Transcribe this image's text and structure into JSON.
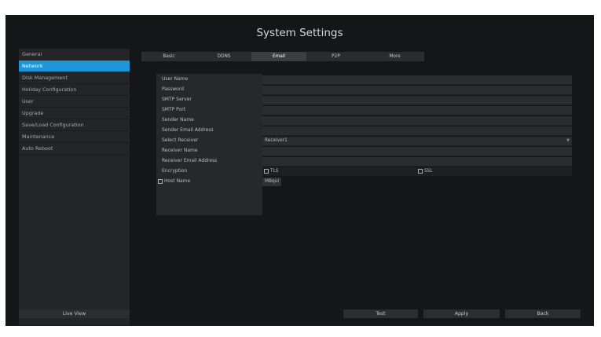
{
  "window": {
    "title": "System Settings"
  },
  "sidebar": {
    "items": [
      {
        "label": "General",
        "active": false
      },
      {
        "label": "Network",
        "active": true
      },
      {
        "label": "Disk Management",
        "active": false
      },
      {
        "label": "Holiday Configuration",
        "active": false
      },
      {
        "label": "User",
        "active": false
      },
      {
        "label": "Upgrade",
        "active": false
      },
      {
        "label": "Save/Load Configuration",
        "active": false
      },
      {
        "label": "Maintenance",
        "active": false
      },
      {
        "label": "Auto Reboot",
        "active": false
      }
    ],
    "live_view_label": "Live View"
  },
  "tabs": [
    {
      "label": "Basic",
      "active": false
    },
    {
      "label": "DDNS",
      "active": false
    },
    {
      "label": "Email",
      "active": true
    },
    {
      "label": "P2P",
      "active": false
    },
    {
      "label": "More",
      "active": false
    }
  ],
  "email_form": {
    "user_name": {
      "label": "User Name",
      "value": ""
    },
    "password": {
      "label": "Password",
      "value": ""
    },
    "smtp_server": {
      "label": "SMTP Server",
      "value": ""
    },
    "smtp_port": {
      "label": "SMTP Port",
      "value": ""
    },
    "sender_name": {
      "label": "Sender Name",
      "value": ""
    },
    "sender_email": {
      "label": "Sender Email Address",
      "value": ""
    },
    "select_receiver": {
      "label": "Select Receiver",
      "value": "Receiver1"
    },
    "receiver_name": {
      "label": "Receiver Name",
      "value": ""
    },
    "receiver_email": {
      "label": "Receiver Email Address",
      "value": ""
    },
    "encryption": {
      "label": "Encryption",
      "tls": "TLS",
      "ssl": "SSL"
    },
    "host_name": {
      "label": "Host Name",
      "value": "MBqul",
      "checked": false
    }
  },
  "footer": {
    "test_label": "Test",
    "apply_label": "Apply",
    "back_label": "Back"
  },
  "colors": {
    "background": "#151617",
    "accent": "#1e95d6",
    "panel": "#232526"
  },
  "icons": {
    "dropdown": "chevron-down-icon",
    "checkbox": "checkbox-icon"
  }
}
